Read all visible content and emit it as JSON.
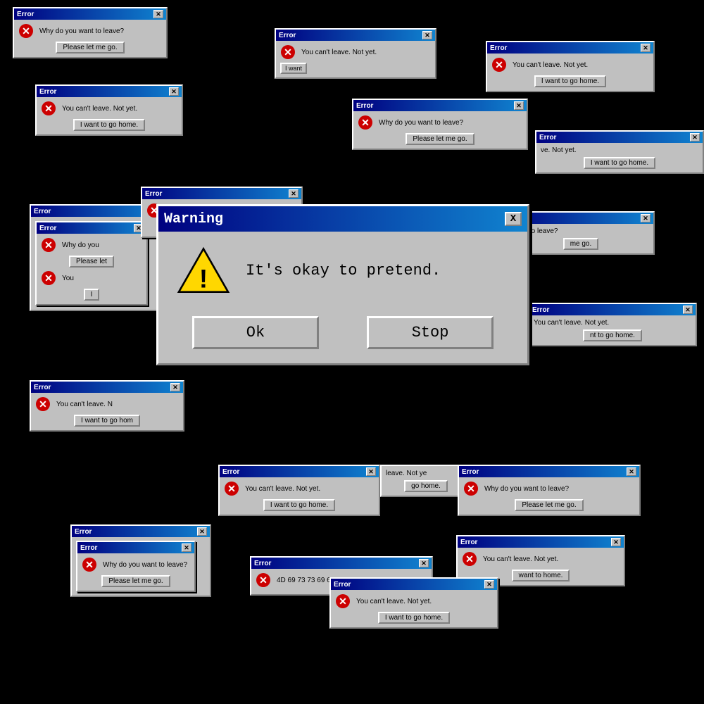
{
  "dialogs": {
    "warning": {
      "title": "Warning",
      "close_label": "X",
      "message": "It's okay to pretend.",
      "ok_label": "Ok",
      "stop_label": "Stop"
    },
    "error_title": "Error",
    "messages": {
      "why_leave": "Why do you want to leave?",
      "cant_leave": "You can't leave. Not yet.",
      "cant_leave_short": "You can't leave. N",
      "hex": "4D 69 73 73 69 6E 67"
    },
    "buttons": {
      "please_let": "Please let me go.",
      "i_want": "I want to go home.",
      "i_want_short": "I want to go hom"
    }
  }
}
